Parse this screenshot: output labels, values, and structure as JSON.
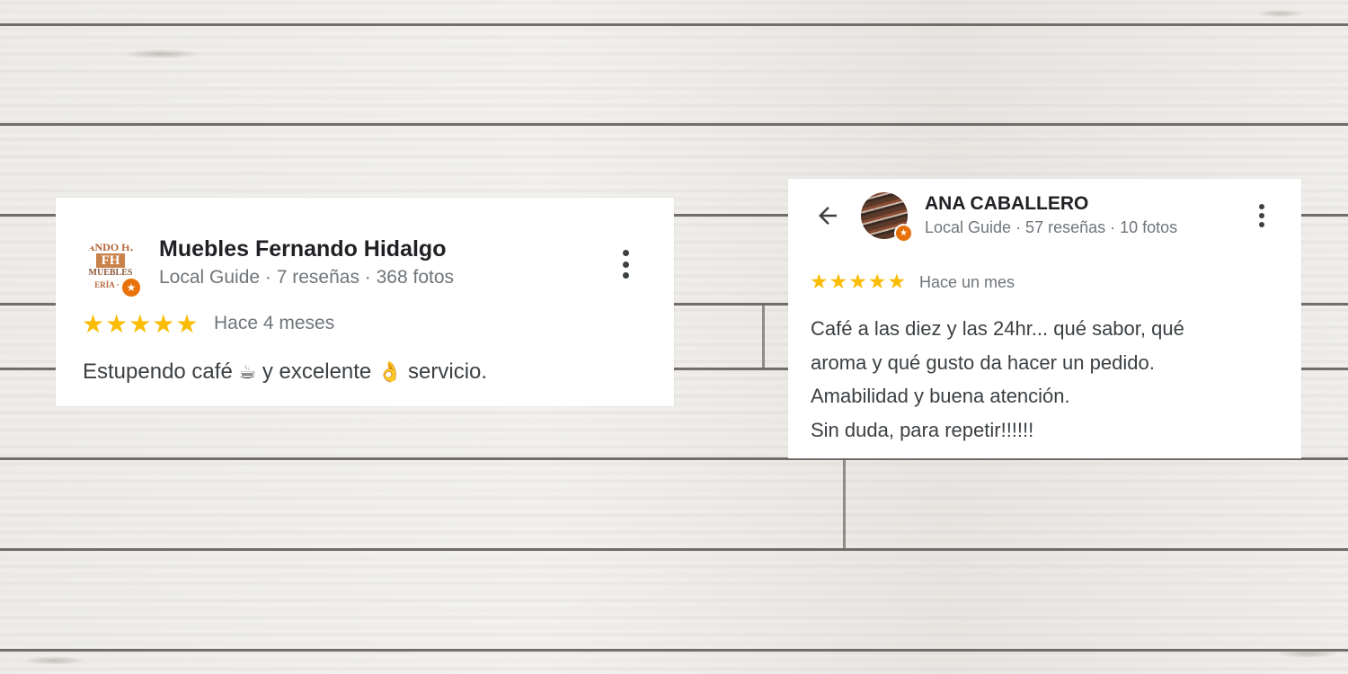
{
  "reviews": [
    {
      "author": "Muebles Fernando Hidalgo",
      "avatar_text": {
        "top": "ANDO HI",
        "mid": "FH",
        "sub": "MUEBLES",
        "bottom": "ERÍA · E"
      },
      "meta": "Local Guide · 7 reseñas · 368 fotos",
      "rating": 5,
      "stars": "★★★★★",
      "date": "Hace 4 meses",
      "text_parts": [
        "Estupendo café ",
        "☕",
        " y excelente ",
        "👌",
        " servicio."
      ]
    },
    {
      "author": "ANA CABALLERO",
      "meta": "Local Guide · 57 reseñas · 10 fotos",
      "rating": 5,
      "stars": "★★★★★",
      "date": "Hace un mes",
      "text_lines": [
        "Café a las diez y las 24hr... qué sabor, qué",
        "aroma y qué gusto da hacer un pedido.",
        "Amabilidad y buena atención.",
        "Sin duda, para repetir!!!!!!"
      ]
    }
  ],
  "badge_glyph": "★",
  "icons": {
    "back": "arrow-back-icon",
    "more": "more-vert-icon",
    "star": "star-icon"
  },
  "colors": {
    "star": "#fbbc04",
    "badge": "#e8710a",
    "name": "#202124",
    "meta": "#70757a"
  }
}
